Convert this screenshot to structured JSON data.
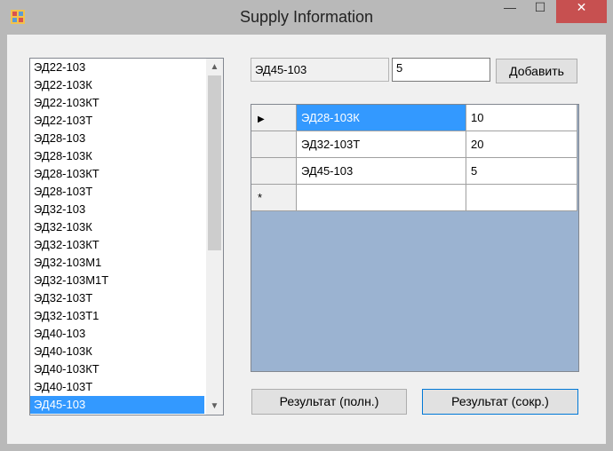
{
  "window": {
    "title": "Supply Information",
    "controls": {
      "minimize": "—",
      "maximize": "☐",
      "close": "✕"
    }
  },
  "listbox": {
    "items": [
      "ЭД22-103",
      "ЭД22-103К",
      "ЭД22-103КТ",
      "ЭД22-103Т",
      "ЭД28-103",
      "ЭД28-103К",
      "ЭД28-103КТ",
      "ЭД28-103Т",
      "ЭД32-103",
      "ЭД32-103К",
      "ЭД32-103КТ",
      "ЭД32-103М1",
      "ЭД32-103М1Т",
      "ЭД32-103Т",
      "ЭД32-103Т1",
      "ЭД40-103",
      "ЭД40-103К",
      "ЭД40-103КТ",
      "ЭД40-103Т",
      "ЭД45-103"
    ],
    "selected": "ЭД45-103",
    "scroll_up": "▲",
    "scroll_down": "▼"
  },
  "selected_item_box": {
    "value": "ЭД45-103"
  },
  "quantity_input": {
    "value": "5"
  },
  "add_button": {
    "label": "Добавить"
  },
  "grid": {
    "rows": [
      {
        "name": "ЭД28-103К",
        "qty": "10",
        "current": true
      },
      {
        "name": "ЭД32-103Т",
        "qty": "20",
        "current": false
      },
      {
        "name": "ЭД45-103",
        "qty": "5",
        "current": false
      }
    ],
    "current_row_marker": "▶",
    "new_row_marker": "*"
  },
  "buttons": {
    "result_full": "Результат (полн.)",
    "result_short": "Результат (сокр.)"
  },
  "colors": {
    "selection": "#3399ff",
    "grid_background": "#9bb3d1",
    "close_button": "#c75050"
  }
}
